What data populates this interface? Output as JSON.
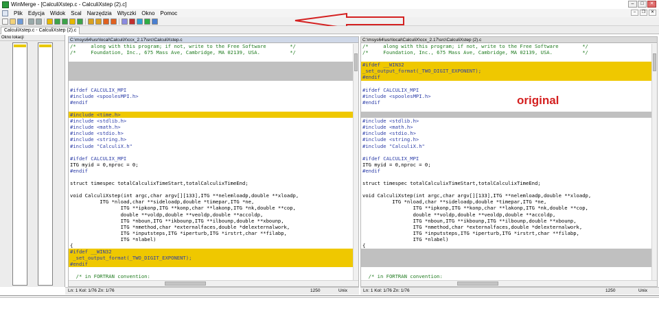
{
  "window": {
    "title": "WinMerge - [CalculiXstep.c - CalculiXstep (2).c]"
  },
  "menu": [
    "Plik",
    "Edycja",
    "Widok",
    "Scal",
    "Narzędzia",
    "Wtyczki",
    "Okno",
    "Pomoc"
  ],
  "toolbar": {
    "icons": [
      "new-icon",
      "open-icon",
      "save-icon",
      "undo-icon",
      "redo-icon",
      "prev-diff-icon",
      "next-diff-icon",
      "first-diff-icon",
      "current-diff-icon",
      "last-diff-icon",
      "copy-left-icon",
      "copy-right-icon",
      "copy-all-left-icon",
      "copy-all-right-icon",
      "options-icon",
      "filter-icon",
      "refresh-icon",
      "green-icon",
      "compare-icon"
    ]
  },
  "tab": {
    "label": "CalculiXstep.c - CalculiXstep (2).c"
  },
  "location_pane": {
    "title": "Okno lokacji"
  },
  "left_pane": {
    "path": "C:\\msys64\\usr\\local\\CalculiX\\ccx_2.17\\src\\CalculiXstep.c",
    "lines": [
      {
        "t": "/*     along with this program; if not, write to the Free Software        */",
        "k": "comment"
      },
      {
        "t": "/*     Foundation, Inc., 675 Mass Ave, Cambridge, MA 02139, USA.          */",
        "k": "comment"
      },
      {
        "t": "",
        "k": "blank-ok"
      },
      {
        "t": "",
        "k": "blank"
      },
      {
        "t": "",
        "k": "blank"
      },
      {
        "t": "",
        "k": "blank"
      },
      {
        "t": "",
        "k": "blank-ok"
      },
      {
        "t": "#ifdef CALCULIX_MPI",
        "k": "pre"
      },
      {
        "t": "#include <spoolesMPI.h>",
        "k": "pre"
      },
      {
        "t": "#endif",
        "k": "pre"
      },
      {
        "t": "",
        "k": "blank-ok"
      },
      {
        "t": "#include <time.h>",
        "k": "diff"
      },
      {
        "t": "#include <stdlib.h>",
        "k": "pre"
      },
      {
        "t": "#include <math.h>",
        "k": "pre"
      },
      {
        "t": "#include <stdio.h>",
        "k": "pre"
      },
      {
        "t": "#include <string.h>",
        "k": "pre"
      },
      {
        "t": "#include \"CalculiX.h\"",
        "k": "pre"
      },
      {
        "t": "",
        "k": "blank-ok"
      },
      {
        "t": "#ifdef CALCULIX_MPI",
        "k": "pre"
      },
      {
        "t": "ITG myid = 0,nproc = 0;",
        "k": "txt"
      },
      {
        "t": "#endif",
        "k": "pre"
      },
      {
        "t": "",
        "k": "blank-ok"
      },
      {
        "t": "struct timespec totalCalculixTimeStart,totalCalculixTimeEnd;",
        "k": "txt"
      },
      {
        "t": "",
        "k": "blank-ok"
      },
      {
        "t": "void CalculiXstep(int argc,char argv[][133],ITG **nelemloadp,double **xloadp,",
        "k": "txt"
      },
      {
        "t": "          ITG *nload,char **sideloadp,double *timepar,ITG *ne,",
        "k": "txt"
      },
      {
        "t": "                 ITG **ipkonp,ITG **konp,char **lakonp,ITG *nk,double **cop,",
        "k": "txt"
      },
      {
        "t": "                 double **voldp,double **veoldp,double **accoldp,",
        "k": "txt"
      },
      {
        "t": "                 ITG *nboun,ITG **ikbounp,ITG **ilbounp,double **xbounp,",
        "k": "txt"
      },
      {
        "t": "                 ITG *nmethod,char *externalfaces,double *delexternalwork,",
        "k": "txt"
      },
      {
        "t": "                 ITG *inputsteps,ITG *iperturb,ITG *irstrt,char **filabp,",
        "k": "txt"
      },
      {
        "t": "                 ITG *nlabel)",
        "k": "txt"
      },
      {
        "t": "{",
        "k": "txt"
      },
      {
        "t": "#ifdef __WIN32",
        "k": "diff"
      },
      {
        "t": " _set_output_format(_TWO_DIGIT_EXPONENT);",
        "k": "diff"
      },
      {
        "t": "#endif",
        "k": "diff"
      },
      {
        "t": "",
        "k": "blank-ok"
      },
      {
        "t": "  /* in FORTRAN convention:",
        "k": "comment"
      }
    ],
    "status": {
      "pos": "Ln: 1  Kol: 1/76  Zn: 1/76",
      "encoding": "1250",
      "eol": "Unix"
    }
  },
  "right_pane": {
    "path": "C:\\msys64\\usr\\local\\CalculiX\\ccx_2.17\\src\\CalculiXstep (2).c",
    "lines": [
      {
        "t": "/*     along with this program; if not, write to the Free Software        */",
        "k": "comment"
      },
      {
        "t": "/*     Foundation, Inc., 675 Mass Ave, Cambridge, MA 02139, USA.          */",
        "k": "comment"
      },
      {
        "t": "",
        "k": "blank-ok"
      },
      {
        "t": "#ifdef __WIN32",
        "k": "diff"
      },
      {
        "t": "_set_output_format(_TWO_DIGIT_EXPONENT);",
        "k": "diff"
      },
      {
        "t": "#endif",
        "k": "diff"
      },
      {
        "t": "",
        "k": "blank-ok"
      },
      {
        "t": "#ifdef CALCULIX_MPI",
        "k": "pre"
      },
      {
        "t": "#include <spoolesMPI.h>",
        "k": "pre"
      },
      {
        "t": "#endif",
        "k": "pre"
      },
      {
        "t": "",
        "k": "blank-ok"
      },
      {
        "t": "",
        "k": "blank"
      },
      {
        "t": "#include <stdlib.h>",
        "k": "pre"
      },
      {
        "t": "#include <math.h>",
        "k": "pre"
      },
      {
        "t": "#include <stdio.h>",
        "k": "pre"
      },
      {
        "t": "#include <string.h>",
        "k": "pre"
      },
      {
        "t": "#include \"CalculiX.h\"",
        "k": "pre"
      },
      {
        "t": "",
        "k": "blank-ok"
      },
      {
        "t": "#ifdef CALCULIX_MPI",
        "k": "pre"
      },
      {
        "t": "ITG myid = 0,nproc = 0;",
        "k": "txt"
      },
      {
        "t": "#endif",
        "k": "pre"
      },
      {
        "t": "",
        "k": "blank-ok"
      },
      {
        "t": "struct timespec totalCalculixTimeStart,totalCalculixTimeEnd;",
        "k": "txt"
      },
      {
        "t": "",
        "k": "blank-ok"
      },
      {
        "t": "void CalculiXstep(int argc,char argv[][133],ITG **nelemloadp,double **xloadp,",
        "k": "txt"
      },
      {
        "t": "          ITG *nload,char **sideloadp,double *timepar,ITG *ne,",
        "k": "txt"
      },
      {
        "t": "                 ITG **ipkonp,ITG **konp,char **lakonp,ITG *nk,double **cop,",
        "k": "txt"
      },
      {
        "t": "                 double **voldp,double **veoldp,double **accoldp,",
        "k": "txt"
      },
      {
        "t": "                 ITG *nboun,ITG **ikbounp,ITG **ilbounp,double **xbounp,",
        "k": "txt"
      },
      {
        "t": "                 ITG *nmethod,char *externalfaces,double *delexternalwork,",
        "k": "txt"
      },
      {
        "t": "                 ITG *inputsteps,ITG *iperturb,ITG *irstrt,char **filabp,",
        "k": "txt"
      },
      {
        "t": "                 ITG *nlabel)",
        "k": "txt"
      },
      {
        "t": "{",
        "k": "txt"
      },
      {
        "t": "",
        "k": "blank"
      },
      {
        "t": "",
        "k": "blank"
      },
      {
        "t": "",
        "k": "blank"
      },
      {
        "t": "",
        "k": "blank-ok"
      },
      {
        "t": "  /* in FORTRAN convention:",
        "k": "comment"
      }
    ],
    "status": {
      "pos": "Ln: 1  Kol: 1/76  Zn: 1/76",
      "encoding": "1250",
      "eol": "Unix"
    }
  },
  "annotation": {
    "label": "original",
    "color": "#d42020"
  },
  "colors": {
    "diff": "#efc800",
    "blank": "#c0c0c0",
    "comment": "#1e7a1e",
    "preprocessor": "#2d3ea8"
  }
}
